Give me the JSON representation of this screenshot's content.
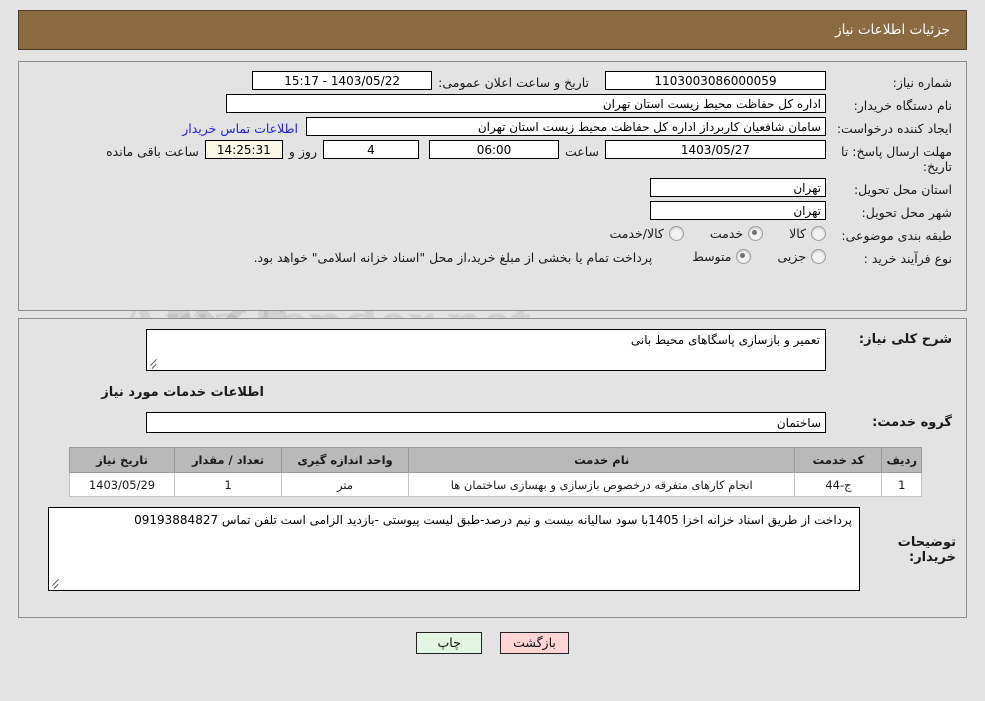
{
  "header": {
    "title": "جزئیات اطلاعات نیاز"
  },
  "summary": {
    "need_number": {
      "label": "شماره نیاز:",
      "value": "1103003086000059"
    },
    "publish_datetime": {
      "label": "تاریخ و ساعت اعلان عمومی:",
      "value": "15:17 - 1403/05/22"
    },
    "buyer_org": {
      "label": "نام دستگاه خریدار:",
      "value": "اداره کل حفاظت محیط زیست استان تهران"
    },
    "request_creator": {
      "label": "ایجاد کننده درخواست:",
      "value": "سامان شافعیان کاربرداز اداره کل حفاظت محیط زیست استان تهران"
    },
    "contact_link": "اطلاعات تماس خریدار",
    "deadline": {
      "label": "مهلت ارسال پاسخ: تا تاریخ:",
      "date": "1403/05/27",
      "time_label": "ساعت",
      "time": "06:00",
      "days": "4",
      "days_label": "روز و",
      "countdown": "14:25:31",
      "countdown_label": "ساعت باقی مانده"
    },
    "delivery_province": {
      "label": "استان محل تحویل:",
      "value": "تهران"
    },
    "delivery_city": {
      "label": "شهر محل تحویل:",
      "value": "تهران"
    },
    "subject_category": {
      "label": "طبقه بندی موضوعی:",
      "options": [
        "کالا",
        "خدمت",
        "کالا/خدمت"
      ],
      "selected": "خدمت"
    },
    "purchase_process": {
      "label": "نوع فرآیند خرید :",
      "options": [
        "جزیی",
        "متوسط"
      ],
      "selected": "متوسط"
    },
    "payment_note": "پرداخت تمام یا بخشی از مبلغ خرید،از محل \"اسناد خزانه اسلامی\" خواهد بود."
  },
  "details": {
    "general_description": {
      "label": "شرح کلی نیاز:",
      "value": "تعمیر و بازسازی پاسگاهای محیط بانی"
    },
    "services_section_title": "اطلاعات خدمات مورد نیاز",
    "service_group": {
      "label": "گروه خدمت:",
      "value": "ساختمان"
    },
    "table": {
      "columns": [
        "ردیف",
        "کد خدمت",
        "نام خدمت",
        "واحد اندازه گیری",
        "تعداد / مقدار",
        "تاریخ نیاز"
      ],
      "rows": [
        {
          "radif": "1",
          "code": "ج-44",
          "name": "انجام کارهای متفرقه درخصوص بازسازی و بهسازی ساختمان ها",
          "unit": "متر",
          "qty": "1",
          "date": "1403/05/29"
        }
      ]
    },
    "buyer_notes": {
      "label": "توضیحات خریدار:",
      "value": "پرداخت از طریق اسناد خزانه اخزا 1405با سود سالیانه بیست و نیم درصد-طبق لیست پیوستی -بازدید الزامی است تلفن تماس 09193884827"
    }
  },
  "footer": {
    "back_label": "بازگشت",
    "print_label": "چاپ"
  },
  "watermark": {
    "text": "AriaTender.net"
  }
}
